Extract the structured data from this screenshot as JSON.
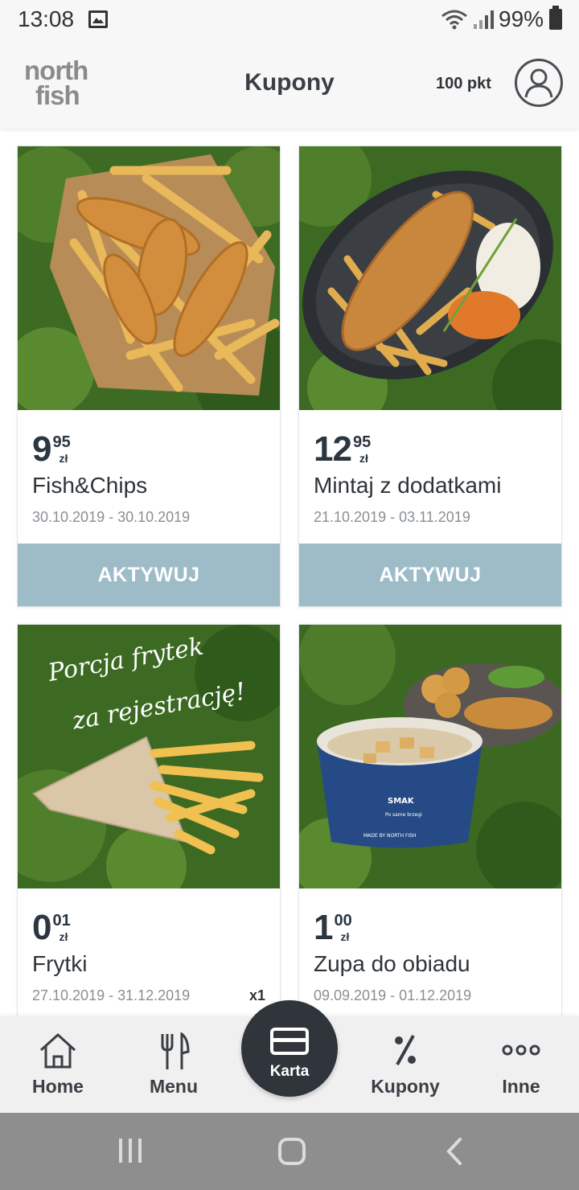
{
  "status_bar": {
    "time": "13:08",
    "battery": "99%",
    "icons": [
      "gallery-icon",
      "wifi-icon",
      "signal-icon",
      "battery-icon"
    ]
  },
  "header": {
    "logo_line1": "north",
    "logo_line2": "fish",
    "title": "Kupony",
    "points": "100 pkt"
  },
  "coupons": [
    {
      "price_main": "9",
      "price_cents": "95",
      "currency": "zł",
      "title": "Fish&Chips",
      "dates": "30.10.2019 - 30.10.2019",
      "qty": "",
      "button": "AKTYWUJ"
    },
    {
      "price_main": "12",
      "price_cents": "95",
      "currency": "zł",
      "title": "Mintaj z dodatkami",
      "dates": "21.10.2019 - 03.11.2019",
      "qty": "",
      "button": "AKTYWUJ"
    },
    {
      "price_main": "0",
      "price_cents": "01",
      "currency": "zł",
      "title": "Frytki",
      "dates": "27.10.2019 - 31.12.2019",
      "qty": "x1",
      "image_text_line1": "Porcja frytek",
      "image_text_line2": "za rejestrację!"
    },
    {
      "price_main": "1",
      "price_cents": "00",
      "currency": "zł",
      "title": "Zupa do obiadu",
      "dates": "09.09.2019 - 01.12.2019",
      "qty": "",
      "cup_label": "SMAK",
      "cup_sub": "Po same brzegi",
      "cup_footer": "MADE BY NORTH FISH"
    }
  ],
  "nav": {
    "home": "Home",
    "menu": "Menu",
    "karta": "Karta",
    "kupony": "Kupony",
    "inne": "Inne"
  },
  "colors": {
    "accent_button": "#9dbcc8",
    "nav_center": "#2f353b",
    "text_dark": "#2b3640",
    "date_gray": "#8a8f94"
  }
}
